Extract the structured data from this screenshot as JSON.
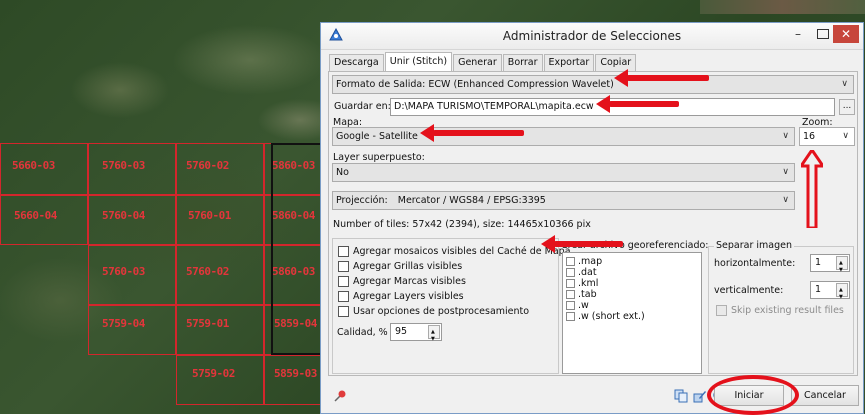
{
  "map": {
    "tiles": [
      {
        "label": "5660-03"
      },
      {
        "label": "5760-03"
      },
      {
        "label": "5760-02"
      },
      {
        "label": "5860-03"
      },
      {
        "label": "5660-04"
      },
      {
        "label": "5760-04"
      },
      {
        "label": "5760-01"
      },
      {
        "label": "5860-04"
      },
      {
        "label": "5760-03"
      },
      {
        "label": "5760-02"
      },
      {
        "label": "5860-03"
      },
      {
        "label": "5759-04"
      },
      {
        "label": "5759-01"
      },
      {
        "label": "5859-04"
      },
      {
        "label": "5759-02"
      },
      {
        "label": "5859-03"
      }
    ]
  },
  "window": {
    "title": "Administrador de Selecciones",
    "controls": {
      "minimize": "–",
      "close": "✕"
    },
    "tabs": [
      {
        "label": "Descarga",
        "active": false
      },
      {
        "label": "Unir (Stitch)",
        "active": true
      },
      {
        "label": "Generar",
        "active": false
      },
      {
        "label": "Borrar",
        "active": false
      },
      {
        "label": "Exportar",
        "active": false
      },
      {
        "label": "Copiar",
        "active": false
      }
    ]
  },
  "form": {
    "formato_label": "Formato de Salida:",
    "formato_value": "ECW (Enhanced Compression Wavelet)",
    "guardar_label": "Guardar en:",
    "guardar_value": "D:\\MAPA TURISMO\\TEMPORAL\\mapita.ecw",
    "browse_label": "...",
    "mapa_label": "Mapa:",
    "mapa_value": "Google - Satellite",
    "zoom_label": "Zoom:",
    "zoom_value": "16",
    "layer_label": "Layer superpuesto:",
    "layer_value": "No",
    "proyeccion_label": "Projección:",
    "proyeccion_value": "Mercator / WGS84 / EPSG:3395",
    "tiles_info": "Number of tiles: 57x42 (2394), size: 14465x10366 pix"
  },
  "options": {
    "checkboxes": [
      {
        "label": "Agregar mosaicos visibles del Caché de Mapa",
        "checked": false
      },
      {
        "label": "Agregar Grillas visibles",
        "checked": false
      },
      {
        "label": "Agregar Marcas visibles",
        "checked": false
      },
      {
        "label": "Agregar Layers visibles",
        "checked": false
      },
      {
        "label": "Usar opciones de postprocesamiento",
        "checked": false
      }
    ],
    "calidad_label": "Calidad, %",
    "calidad_value": "95"
  },
  "georef": {
    "label": "Crear archivo georeferenciado:",
    "items": [
      {
        "label": ".map"
      },
      {
        "label": ".dat"
      },
      {
        "label": ".kml"
      },
      {
        "label": ".tab"
      },
      {
        "label": ".w"
      },
      {
        "label": ".w (short ext.)"
      }
    ]
  },
  "split": {
    "label": "Separar imagen",
    "horizontal_label": "horizontalmente:",
    "horizontal_value": "1",
    "vertical_label": "verticalmente:",
    "vertical_value": "1",
    "skip_label": "Skip existing result files"
  },
  "footer": {
    "iniciar_label": "Iniciar",
    "cancelar_label": "Cancelar"
  },
  "colors": {
    "annotation_red": "#e4111b",
    "grid_red": "#d3262c",
    "window_border": "#7a9cc6",
    "close_button": "#c7463b"
  }
}
